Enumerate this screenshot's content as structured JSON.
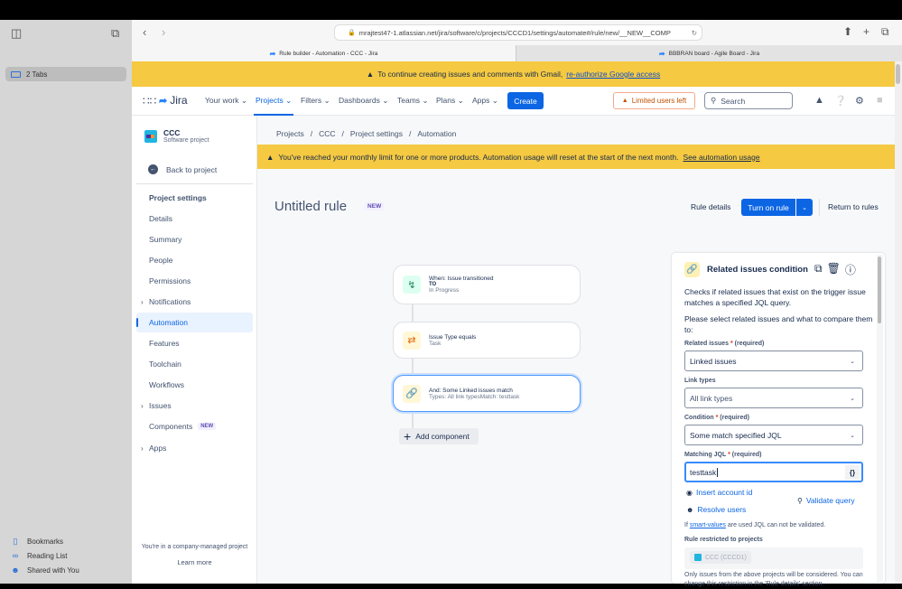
{
  "safari": {
    "tabs_label": "2 Tabs",
    "bottom": [
      {
        "icon": "bookmark-icon",
        "label": "Bookmarks"
      },
      {
        "icon": "reading-list-icon",
        "label": "Reading List"
      },
      {
        "icon": "shared-icon",
        "label": "Shared with You"
      }
    ],
    "url": "mrajtest47-1.atlassian.net/jira/software/c/projects/CCCD1/settings/automate#/rule/new/__NEW__COMP",
    "tabs": [
      {
        "title": "Rule builder - Automation - CCC - Jira",
        "active": true
      },
      {
        "title": "BBBRAN board - Agile Board - Jira",
        "active": false
      }
    ]
  },
  "google_banner": {
    "text": "To continue creating issues and comments with Gmail,",
    "link": "re-authorize Google access"
  },
  "topnav": {
    "logo": "Jira",
    "items": [
      "Your work",
      "Projects",
      "Filters",
      "Dashboards",
      "Teams",
      "Plans",
      "Apps"
    ],
    "active": "Projects",
    "create": "Create",
    "limited": "Limited users left",
    "search_placeholder": "Search"
  },
  "project": {
    "name": "CCC",
    "type": "Software project",
    "back": "Back to project",
    "settings_heading": "Project settings",
    "items": [
      {
        "label": "Details",
        "expandable": false
      },
      {
        "label": "Summary",
        "expandable": false
      },
      {
        "label": "People",
        "expandable": false
      },
      {
        "label": "Permissions",
        "expandable": false
      },
      {
        "label": "Notifications",
        "expandable": true
      },
      {
        "label": "Automation",
        "expandable": false,
        "active": true
      },
      {
        "label": "Features",
        "expandable": false
      },
      {
        "label": "Toolchain",
        "expandable": false
      },
      {
        "label": "Workflows",
        "expandable": false
      },
      {
        "label": "Issues",
        "expandable": true
      },
      {
        "label": "Components",
        "expandable": false,
        "badge": "NEW"
      },
      {
        "label": "Apps",
        "expandable": true
      }
    ],
    "company_note": "You're in a company-managed project",
    "learn_more": "Learn more"
  },
  "breadcrumbs": [
    "Projects",
    "CCC",
    "Project settings",
    "Automation"
  ],
  "automation_banner": {
    "text": "You've reached your monthly limit for one or more products. Automation usage will reset at the start of the next month.",
    "link": "See automation usage"
  },
  "rule": {
    "title": "Untitled rule",
    "badge": "NEW",
    "rule_details": "Rule details",
    "turn_on": "Turn on rule",
    "return": "Return to rules"
  },
  "components": [
    {
      "type": "trigger",
      "line1": "When: Issue transitioned",
      "line2": "TO",
      "line3": "In Progress"
    },
    {
      "type": "condition",
      "line1": "Issue Type equals",
      "line3": "Task"
    },
    {
      "type": "related",
      "line1": "And: Some Linked issues match",
      "line3": "Types: All link typesMatch: testtask"
    }
  ],
  "add_component": "Add component",
  "panel": {
    "title": "Related issues condition",
    "desc": "Checks if related issues that exist on the trigger issue matches a specified JQL query.",
    "prompt": "Please select related issues and what to compare them to:",
    "related_label": "Related issues",
    "required": "(required)",
    "related_value": "Linked issues",
    "link_types_label": "Link types",
    "link_types_value": "All link types",
    "condition_label": "Condition",
    "condition_value": "Some match specified JQL",
    "jql_label": "Matching JQL",
    "jql_value": "testtask",
    "jql_button": "{}",
    "insert_account": "Insert account id",
    "validate": "Validate query",
    "resolve_users": "Resolve users",
    "smart_note_pre": "If",
    "smart_link": "smart-values",
    "smart_note_post": "are used JQL can not be validated.",
    "restricted_label": "Rule restricted to projects",
    "restricted_project": "CCC (CCCD1)",
    "restricted_note": "Only issues from the above projects will be considered. You can change this restriction in the 'Rule details' section."
  }
}
